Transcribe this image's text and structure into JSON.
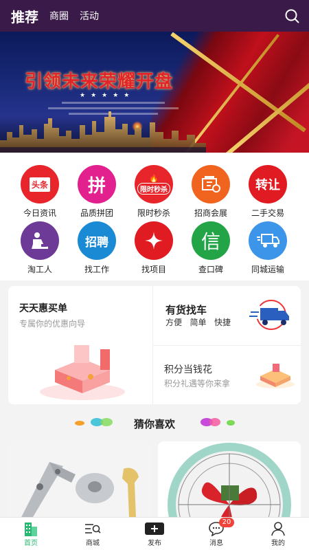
{
  "header": {
    "tabs": [
      {
        "label": "推荐",
        "active": true
      },
      {
        "label": "商圈",
        "active": false
      },
      {
        "label": "活动",
        "active": false
      }
    ],
    "search_icon": "search-icon",
    "bg_color": "#3a1a48"
  },
  "banner": {
    "title": "引领未来荣耀开盘"
  },
  "icon_grid": [
    {
      "label": "今日资讯",
      "icon": "headline-icon",
      "glyph": "头条",
      "color": "#e8252b"
    },
    {
      "label": "品质拼团",
      "icon": "group-buy-icon",
      "glyph": "拼",
      "color": "#e2218e"
    },
    {
      "label": "限时秒杀",
      "icon": "flash-sale-icon",
      "glyph": "限时秒杀",
      "color": "#e8252b"
    },
    {
      "label": "招商会展",
      "icon": "expo-icon",
      "glyph": "",
      "color": "#f0641f"
    },
    {
      "label": "二手交易",
      "icon": "second-hand-icon",
      "glyph": "转让",
      "color": "#e01b22"
    },
    {
      "label": "淘工人",
      "icon": "worker-icon",
      "glyph": "",
      "color": "#6e3a97"
    },
    {
      "label": "找工作",
      "icon": "job-icon",
      "glyph": "招聘",
      "color": "#1a8ad4"
    },
    {
      "label": "找项目",
      "icon": "project-icon",
      "glyph": "",
      "color": "#e01b22"
    },
    {
      "label": "查口碑",
      "icon": "reputation-icon",
      "glyph": "信",
      "color": "#22a447"
    },
    {
      "label": "同城运输",
      "icon": "truck-icon",
      "glyph": "",
      "color": "#3c95e8"
    }
  ],
  "promo": {
    "left": {
      "title": "天天惠买单",
      "subtitle": "专属你的优惠向导"
    },
    "right_top": {
      "title": "有货找车",
      "tags": [
        "方便",
        "简单",
        "快捷"
      ]
    },
    "right_bottom": {
      "title": "积分当钱花",
      "subtitle": "积分礼遇等你来拿"
    }
  },
  "section": {
    "title": "猜你喜欢"
  },
  "bottom_nav": [
    {
      "label": "首页",
      "icon": "home-building-icon",
      "active": true
    },
    {
      "label": "商城",
      "icon": "mall-search-icon",
      "active": false
    },
    {
      "label": "发布",
      "icon": "publish-plus-icon",
      "active": false
    },
    {
      "label": "消息",
      "icon": "message-icon",
      "active": false,
      "badge": "20"
    },
    {
      "label": "我的",
      "icon": "profile-icon",
      "active": false
    }
  ]
}
